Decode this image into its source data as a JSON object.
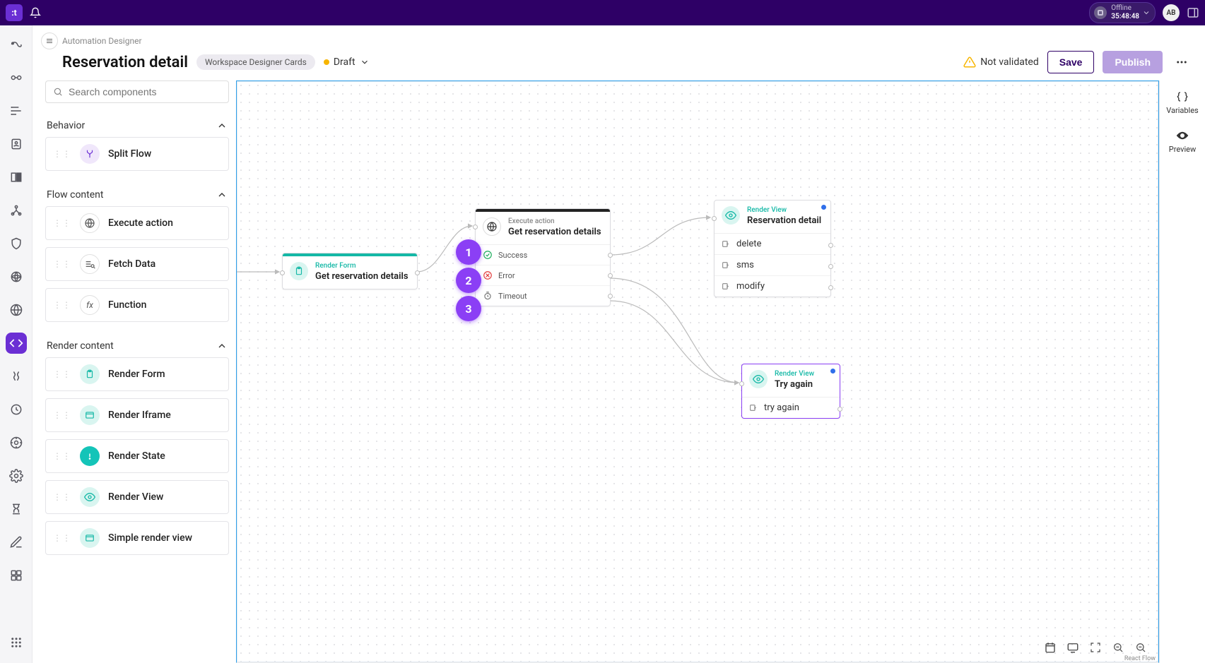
{
  "topbar": {
    "offline_label": "Offline",
    "offline_time": "35:48:48",
    "avatar": "AB"
  },
  "header": {
    "breadcrumb": "Automation Designer",
    "title": "Reservation detail",
    "tag": "Workspace Designer Cards",
    "status": "Draft",
    "not_validated": "Not validated",
    "save": "Save",
    "publish": "Publish"
  },
  "search": {
    "placeholder": "Search components"
  },
  "sections": {
    "behavior": {
      "label": "Behavior",
      "items": [
        {
          "label": "Split Flow"
        }
      ]
    },
    "flow": {
      "label": "Flow content",
      "items": [
        {
          "label": "Execute action"
        },
        {
          "label": "Fetch Data"
        },
        {
          "label": "Function"
        }
      ]
    },
    "render": {
      "label": "Render content",
      "items": [
        {
          "label": "Render Form"
        },
        {
          "label": "Render Iframe"
        },
        {
          "label": "Render State"
        },
        {
          "label": "Render View"
        },
        {
          "label": "Simple render view"
        }
      ]
    }
  },
  "nodes": {
    "renderForm": {
      "kind": "Render Form",
      "title": "Get reservation details"
    },
    "execAction": {
      "kind": "Execute action",
      "title": "Get reservation details",
      "outcomes": [
        {
          "label": "Success",
          "badge": "1"
        },
        {
          "label": "Error",
          "badge": "2"
        },
        {
          "label": "Timeout",
          "badge": "3"
        }
      ]
    },
    "renderView1": {
      "kind": "Render View",
      "title": "Reservation detail",
      "actions": [
        {
          "label": "delete"
        },
        {
          "label": "sms"
        },
        {
          "label": "modify"
        }
      ]
    },
    "renderView2": {
      "kind": "Render View",
      "title": "Try again",
      "actions": [
        {
          "label": "try again"
        }
      ]
    }
  },
  "rightDock": {
    "variables": "Variables",
    "preview": "Preview"
  },
  "attribution": "React Flow"
}
